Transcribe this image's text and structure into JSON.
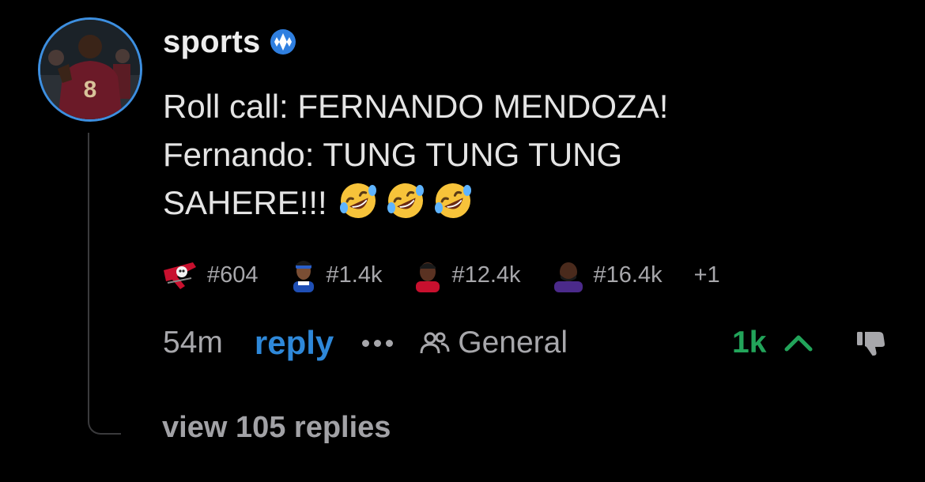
{
  "comment": {
    "username": "sports",
    "verified_badge_icon": "verified-badge-icon",
    "message_lines": [
      "Roll call: FERNANDO MENDOZA!",
      "Fernando: TUNG TUNG TUNG",
      "SAHERE!!!"
    ],
    "emojis": [
      "rolling-on-floor-laughing-emoji",
      "rolling-on-floor-laughing-emoji",
      "rolling-on-floor-laughing-emoji"
    ],
    "flairs": [
      {
        "icon": "buccaneers-logo-icon",
        "label": "#604"
      },
      {
        "icon": "player-avatar-icon",
        "label": "#1.4k"
      },
      {
        "icon": "player-avatar-icon",
        "label": "#12.4k"
      },
      {
        "icon": "player-avatar-icon",
        "label": "#16.4k"
      }
    ],
    "flair_more": "+1",
    "timestamp": "54m",
    "reply_label": "reply",
    "channel_label": "General",
    "vote_count": "1k",
    "view_replies_label": "view 105 replies"
  },
  "colors": {
    "background": "#000000",
    "reply_blue": "#2e88d9",
    "upvote_green": "#22a45a",
    "muted_text": "#a7a7ab",
    "avatar_ring": "#3d8fe0"
  }
}
